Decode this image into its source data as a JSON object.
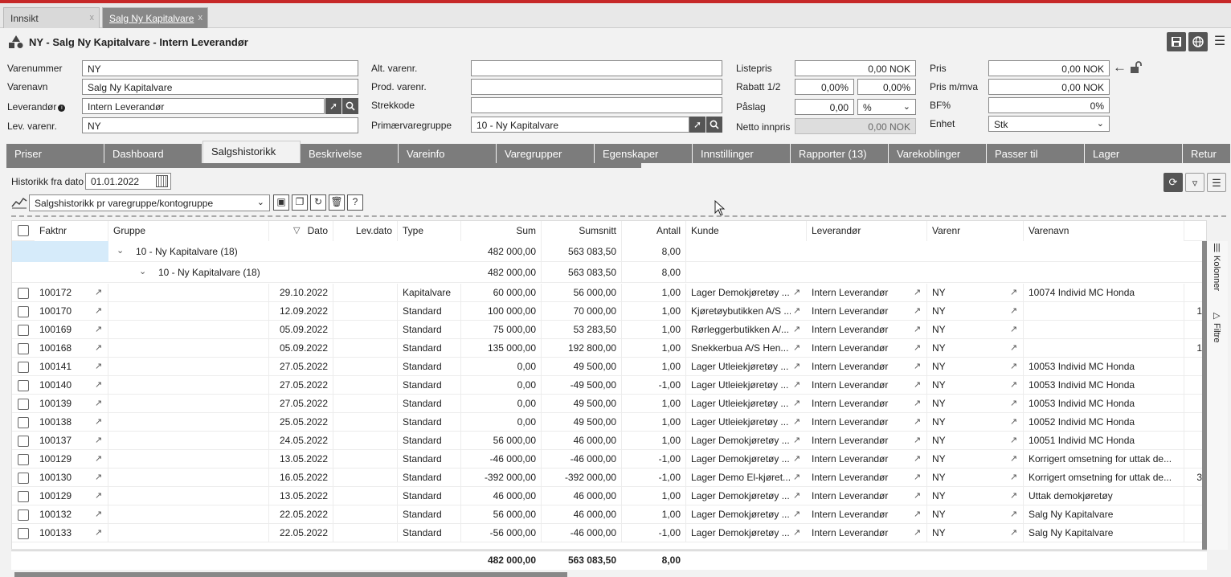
{
  "doc_tabs": [
    {
      "label": "Innsikt",
      "close": "x"
    },
    {
      "label": "Salg Ny Kapitalvare",
      "close": "x"
    }
  ],
  "header": {
    "title": "NY - Salg Ny Kapitalvare - Intern Leverandør"
  },
  "form": {
    "varenummer": {
      "label": "Varenummer",
      "value": "NY"
    },
    "varenavn": {
      "label": "Varenavn",
      "value": "Salg Ny Kapitalvare"
    },
    "leverandor": {
      "label": "Leverandør",
      "value": "Intern Leverandør"
    },
    "lev_varenr": {
      "label": "Lev. varenr.",
      "value": "NY"
    },
    "alt_varenr": {
      "label": "Alt. varenr.",
      "value": ""
    },
    "prod_varenr": {
      "label": "Prod. varenr.",
      "value": ""
    },
    "strekkode": {
      "label": "Strekkode",
      "value": ""
    },
    "primaervaregruppe": {
      "label": "Primærvaregruppe",
      "value": "10 - Ny Kapitalvare"
    },
    "listepris": {
      "label": "Listepris",
      "value": "0,00 NOK"
    },
    "rabatt": {
      "label": "Rabatt 1/2",
      "value1": "0,00%",
      "value2": "0,00%"
    },
    "paslag": {
      "label": "Påslag",
      "value": "0,00",
      "unit": "%"
    },
    "netto_innpris": {
      "label": "Netto innpris",
      "value": "0,00 NOK"
    },
    "pris": {
      "label": "Pris",
      "value": "0,00 NOK"
    },
    "pris_mva": {
      "label": "Pris m/mva",
      "value": "0,00 NOK"
    },
    "bf": {
      "label": "BF%",
      "value": "0%"
    },
    "enhet": {
      "label": "Enhet",
      "value": "Stk"
    }
  },
  "tabs": [
    "Priser",
    "Dashboard",
    "Salgshistorikk",
    "Beskrivelse",
    "Vareinfo",
    "Varegrupper",
    "Egenskaper",
    "Innstillinger",
    "Rapporter (13)",
    "Varekoblinger",
    "Passer til",
    "Lager",
    "Retur"
  ],
  "history": {
    "from_label": "Historikk fra dato",
    "from_value": "01.01.2022",
    "view": "Salgshistorikk pr varegruppe/kontogruppe"
  },
  "columns": [
    "Faktnr",
    "Gruppe",
    "Dato",
    "Lev.dato",
    "Type",
    "Sum",
    "Sumsnitt",
    "Antall",
    "Kunde",
    "Leverandør",
    "Varenr",
    "Varenavn"
  ],
  "groups": [
    {
      "label": "10 - Ny Kapitalvare (18)",
      "sum": "482 000,00",
      "snitt": "563 083,50",
      "antall": "8,00"
    },
    {
      "label": "10 - Ny Kapitalvare (18)",
      "sum": "482 000,00",
      "snitt": "563 083,50",
      "antall": "8,00"
    }
  ],
  "rows": [
    {
      "faktnr": "100172",
      "dato": "29.10.2022",
      "type": "Kapitalvare",
      "sum": "60 000,00",
      "snitt": "56 000,00",
      "antall": "1,00",
      "kunde": "Lager Demokjøretøy ...",
      "lev": "Intern Leverandør",
      "varenr": "NY",
      "varenavn": "10074 Individ MC Honda",
      "extra": ""
    },
    {
      "faktnr": "100170",
      "dato": "12.09.2022",
      "type": "Standard",
      "sum": "100 000,00",
      "snitt": "70 000,00",
      "antall": "1,00",
      "kunde": "Kjøretøybutikken A/S ...",
      "lev": "Intern Leverandør",
      "varenr": "NY",
      "varenavn": "",
      "extra": "1"
    },
    {
      "faktnr": "100169",
      "dato": "05.09.2022",
      "type": "Standard",
      "sum": "75 000,00",
      "snitt": "53 283,50",
      "antall": "1,00",
      "kunde": "Rørleggerbutikken A/...",
      "lev": "Intern Leverandør",
      "varenr": "NY",
      "varenavn": "",
      "extra": ""
    },
    {
      "faktnr": "100168",
      "dato": "05.09.2022",
      "type": "Standard",
      "sum": "135 000,00",
      "snitt": "192 800,00",
      "antall": "1,00",
      "kunde": "Snekkerbua A/S Hen...",
      "lev": "Intern Leverandør",
      "varenr": "NY",
      "varenavn": "",
      "extra": "1"
    },
    {
      "faktnr": "100141",
      "dato": "27.05.2022",
      "type": "Standard",
      "sum": "0,00",
      "snitt": "49 500,00",
      "antall": "1,00",
      "kunde": "Lager Utleiekjøretøy ...",
      "lev": "Intern Leverandør",
      "varenr": "NY",
      "varenavn": "10053 Individ MC Honda",
      "extra": ""
    },
    {
      "faktnr": "100140",
      "dato": "27.05.2022",
      "type": "Standard",
      "sum": "0,00",
      "snitt": "-49 500,00",
      "antall": "-1,00",
      "kunde": "Lager Utleiekjøretøy ...",
      "lev": "Intern Leverandør",
      "varenr": "NY",
      "varenavn": "10053 Individ MC Honda",
      "extra": ""
    },
    {
      "faktnr": "100139",
      "dato": "27.05.2022",
      "type": "Standard",
      "sum": "0,00",
      "snitt": "49 500,00",
      "antall": "1,00",
      "kunde": "Lager Utleiekjøretøy ...",
      "lev": "Intern Leverandør",
      "varenr": "NY",
      "varenavn": "10053 Individ MC Honda",
      "extra": ""
    },
    {
      "faktnr": "100138",
      "dato": "25.05.2022",
      "type": "Standard",
      "sum": "0,00",
      "snitt": "49 500,00",
      "antall": "1,00",
      "kunde": "Lager Utleiekjøretøy ...",
      "lev": "Intern Leverandør",
      "varenr": "NY",
      "varenavn": "10052 Individ MC Honda",
      "extra": ""
    },
    {
      "faktnr": "100137",
      "dato": "24.05.2022",
      "type": "Standard",
      "sum": "56 000,00",
      "snitt": "46 000,00",
      "antall": "1,00",
      "kunde": "Lager Demokjøretøy ...",
      "lev": "Intern Leverandør",
      "varenr": "NY",
      "varenavn": "10051 Individ MC Honda",
      "extra": ""
    },
    {
      "faktnr": "100129",
      "dato": "13.05.2022",
      "type": "Standard",
      "sum": "-46 000,00",
      "snitt": "-46 000,00",
      "antall": "-1,00",
      "kunde": "Lager Demokjøretøy ...",
      "lev": "Intern Leverandør",
      "varenr": "NY",
      "varenavn": "Korrigert omsetning for uttak de...",
      "extra": ""
    },
    {
      "faktnr": "100130",
      "dato": "16.05.2022",
      "type": "Standard",
      "sum": "-392 000,00",
      "snitt": "-392 000,00",
      "antall": "-1,00",
      "kunde": "Lager Demo El-kjøret...",
      "lev": "Intern Leverandør",
      "varenr": "NY",
      "varenavn": "Korrigert omsetning for uttak de...",
      "extra": "3"
    },
    {
      "faktnr": "100129",
      "dato": "13.05.2022",
      "type": "Standard",
      "sum": "46 000,00",
      "snitt": "46 000,00",
      "antall": "1,00",
      "kunde": "Lager Demokjøretøy ...",
      "lev": "Intern Leverandør",
      "varenr": "NY",
      "varenavn": "Uttak demokjøretøy",
      "extra": ""
    },
    {
      "faktnr": "100132",
      "dato": "22.05.2022",
      "type": "Standard",
      "sum": "56 000,00",
      "snitt": "46 000,00",
      "antall": "1,00",
      "kunde": "Lager Demokjøretøy ...",
      "lev": "Intern Leverandør",
      "varenr": "NY",
      "varenavn": "Salg Ny Kapitalvare",
      "extra": ""
    },
    {
      "faktnr": "100133",
      "dato": "22.05.2022",
      "type": "Standard",
      "sum": "-56 000,00",
      "snitt": "-46 000,00",
      "antall": "-1,00",
      "kunde": "Lager Demokjøretøy ...",
      "lev": "Intern Leverandør",
      "varenr": "NY",
      "varenavn": "Salg Ny Kapitalvare",
      "extra": ""
    }
  ],
  "totals": {
    "sum": "482 000,00",
    "snitt": "563 083,50",
    "antall": "8,00"
  },
  "side": {
    "kolonner": "Kolonner",
    "filtre": "Filtre"
  },
  "icons": [
    "shapes-icon",
    "save-icon",
    "globe-icon",
    "menu-icon",
    "arrow-left-icon",
    "unlock-icon",
    "search-icon",
    "link-arrow-icon",
    "calendar-icon",
    "refresh-icon",
    "filter-icon",
    "chart-icon",
    "external-link-icon"
  ]
}
